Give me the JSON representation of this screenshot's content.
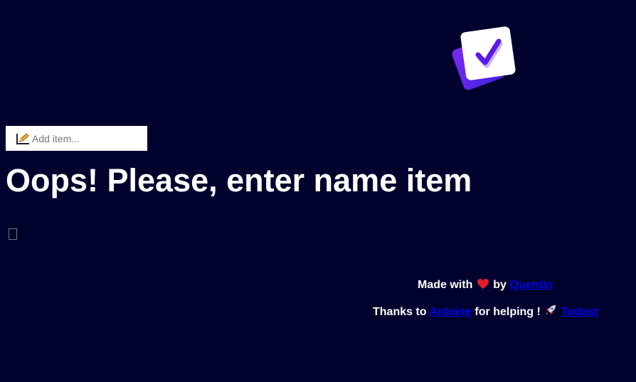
{
  "add_item": {
    "placeholder": "Add item...",
    "value": ""
  },
  "error_message": "Oops! Please, enter name item",
  "footer": {
    "made_with_prefix": "Made with",
    "made_with_by": "by",
    "author_link": "Quentin",
    "thanks_prefix": "Thanks to",
    "helper_link": "Antoine",
    "thanks_middle": "for helping !",
    "project_link": "Todost"
  },
  "icons": {
    "logo": "checkbox-logo-icon",
    "input_prefix": "pencil-icon",
    "heart": "heart-icon",
    "rocket": "rocket-icon",
    "empty_list": "empty-box-glyph"
  },
  "colors": {
    "background": "#00022e",
    "text": "#ffffff",
    "link": "#0000ee",
    "logo_back": "#6219e6",
    "logo_front": "#ffffff",
    "check": "#5d19e6",
    "heart": "#e01f2c"
  }
}
